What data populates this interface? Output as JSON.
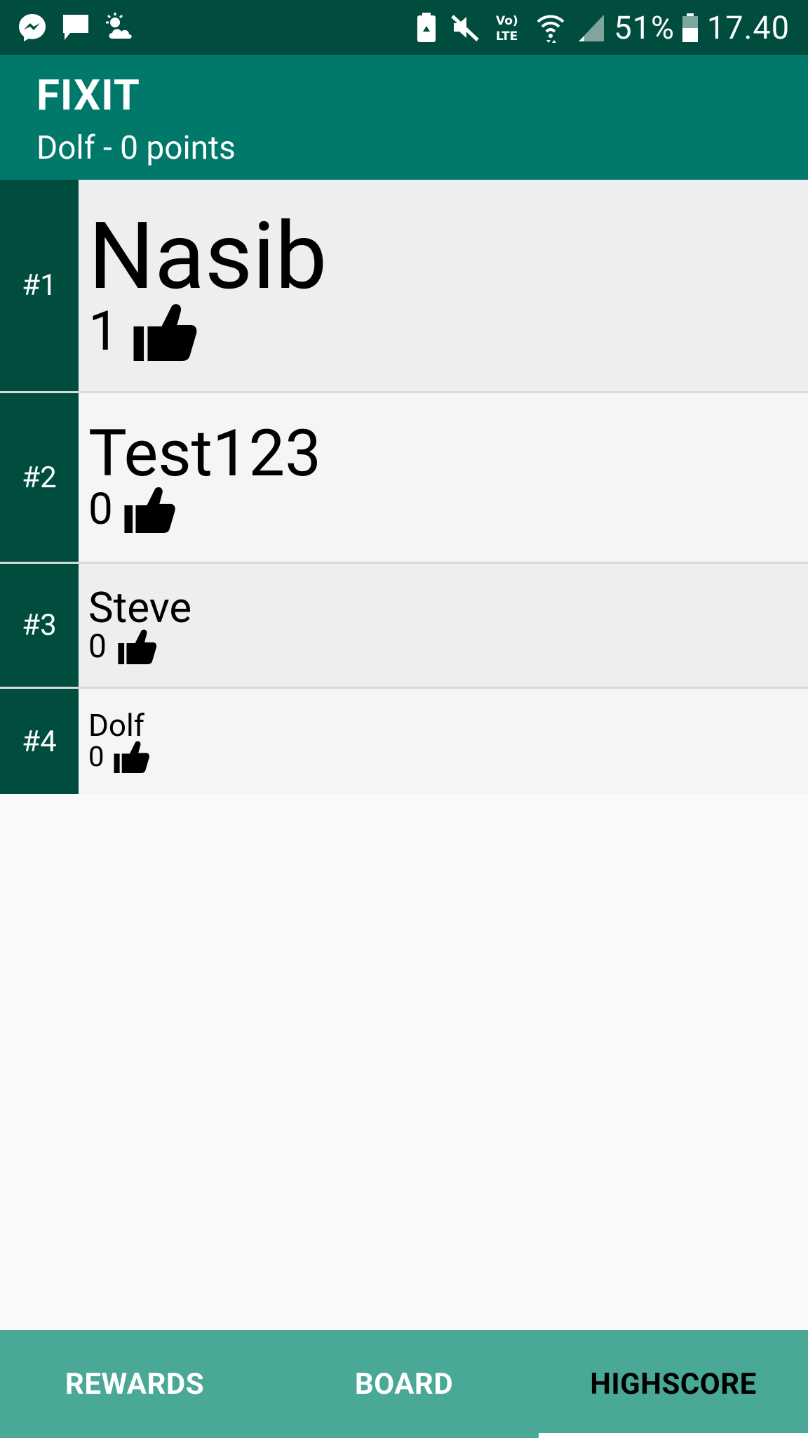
{
  "status_bar": {
    "battery_percent": "51%",
    "time": "17.40",
    "left_icons": [
      "messenger-icon",
      "chat-icon",
      "weather-icon"
    ],
    "right_icons": [
      "battery-saver-icon",
      "mute-icon",
      "volte-icon",
      "wifi-icon",
      "signal-icon",
      "battery-icon"
    ]
  },
  "app_bar": {
    "title": "FIXIT",
    "subtitle": "Dolf - 0 points"
  },
  "highscores": [
    {
      "rank": "#1",
      "name": "Nasib",
      "score": "1",
      "icon": "thumbs-up-icon"
    },
    {
      "rank": "#2",
      "name": "Test123",
      "score": "0",
      "icon": "thumbs-up-icon"
    },
    {
      "rank": "#3",
      "name": "Steve",
      "score": "0",
      "icon": "thumbs-up-icon"
    },
    {
      "rank": "#4",
      "name": "Dolf",
      "score": "0",
      "icon": "thumbs-up-icon"
    }
  ],
  "tabs": [
    {
      "label": "REWARDS",
      "active": false
    },
    {
      "label": "BOARD",
      "active": false
    },
    {
      "label": "HIGHSCORE",
      "active": true
    }
  ],
  "colors": {
    "status_bar": "#004d40",
    "app_bar": "#00796b",
    "tab_bar": "#4aa896",
    "rank_cell": "#004d40"
  }
}
